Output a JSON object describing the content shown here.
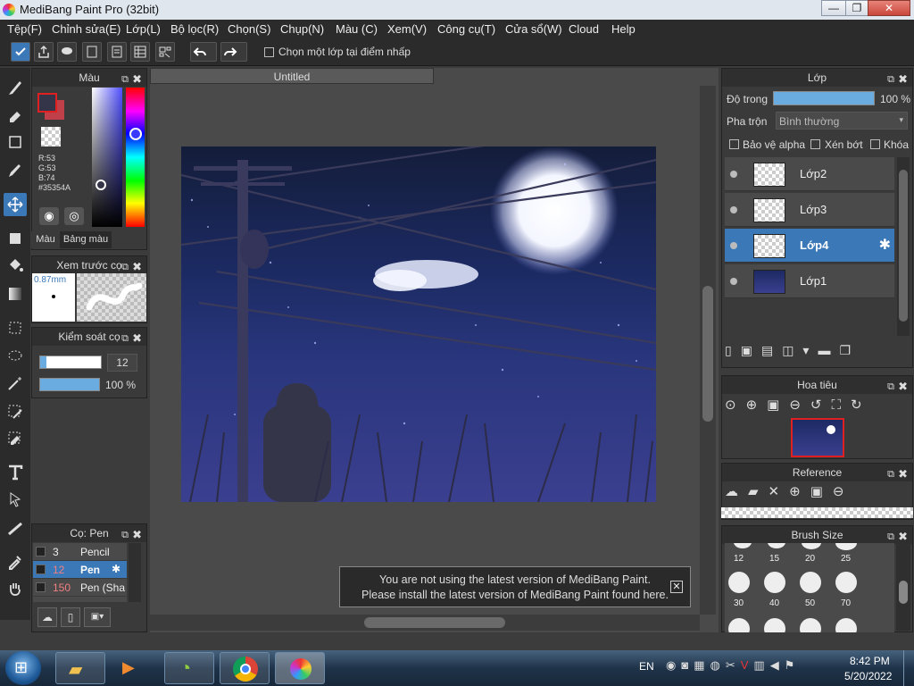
{
  "window": {
    "title": "MediBang Paint Pro (32bit)",
    "min": "—",
    "max": "❐",
    "close": "✕"
  },
  "menu": [
    "Tệp(F)",
    "Chỉnh sửa(E)",
    "Lớp(L)",
    "Bộ lọc(R)",
    "Chọn(S)",
    "Chụp(N)",
    "Màu (C)",
    "Xem(V)",
    "Công cụ(T)",
    "Cửa sổ(W)",
    "Cloud",
    "Help"
  ],
  "toolbar": {
    "select_layer_checkbox": "Chọn một lớp tại điểm nhấp"
  },
  "color_panel": {
    "title": "Màu",
    "r": "R:53",
    "g": "G:53",
    "b": "B:74",
    "hex": "#35354A",
    "tab_color": "Màu",
    "tab_palette": "Bảng màu",
    "primary": "#35354A",
    "secondary": "#c0404a"
  },
  "brush_preview": {
    "title": "Xem trước cọ",
    "size": "0.87mm"
  },
  "brush_control": {
    "title": "Kiểm soát cọ",
    "size_value": "12",
    "opacity_value": "100 %",
    "size_fraction": 0.1,
    "opacity_fraction": 1.0
  },
  "brush_list": {
    "title": "Cọ: Pen",
    "items": [
      {
        "size": "3",
        "name": "Pencil"
      },
      {
        "size": "12",
        "name": "Pen"
      },
      {
        "size": "150",
        "name": "Pen (Sha"
      }
    ]
  },
  "document": {
    "tab": "Untitled"
  },
  "notice": {
    "line1": "You are not using the latest version of MediBang Paint.",
    "line2": "Please install the latest version of MediBang Paint found here.",
    "close": "✕"
  },
  "layer_panel": {
    "title": "Lớp",
    "opacity_label": "Độ trong",
    "opacity_value": "100 %",
    "opacity_fraction": 1.0,
    "blend_label": "Pha trộn",
    "blend_value": "Bình thường",
    "protect_alpha": "Bảo vệ alpha",
    "clipping": "Xén bớt",
    "lock": "Khóa",
    "layers": [
      "Lớp2",
      "Lớp3",
      "Lớp4",
      "Lớp1"
    ],
    "selected_layer": "Lớp4"
  },
  "navigator": {
    "title": "Hoa tiêu"
  },
  "reference": {
    "title": "Reference"
  },
  "brush_size": {
    "title": "Brush Size",
    "sizes_row1": [
      "12",
      "15",
      "20",
      "25"
    ],
    "sizes_row2": [
      "30",
      "40",
      "50",
      "70"
    ]
  },
  "taskbar": {
    "lang": "EN",
    "time": "8:42 PM",
    "date": "5/20/2022"
  }
}
